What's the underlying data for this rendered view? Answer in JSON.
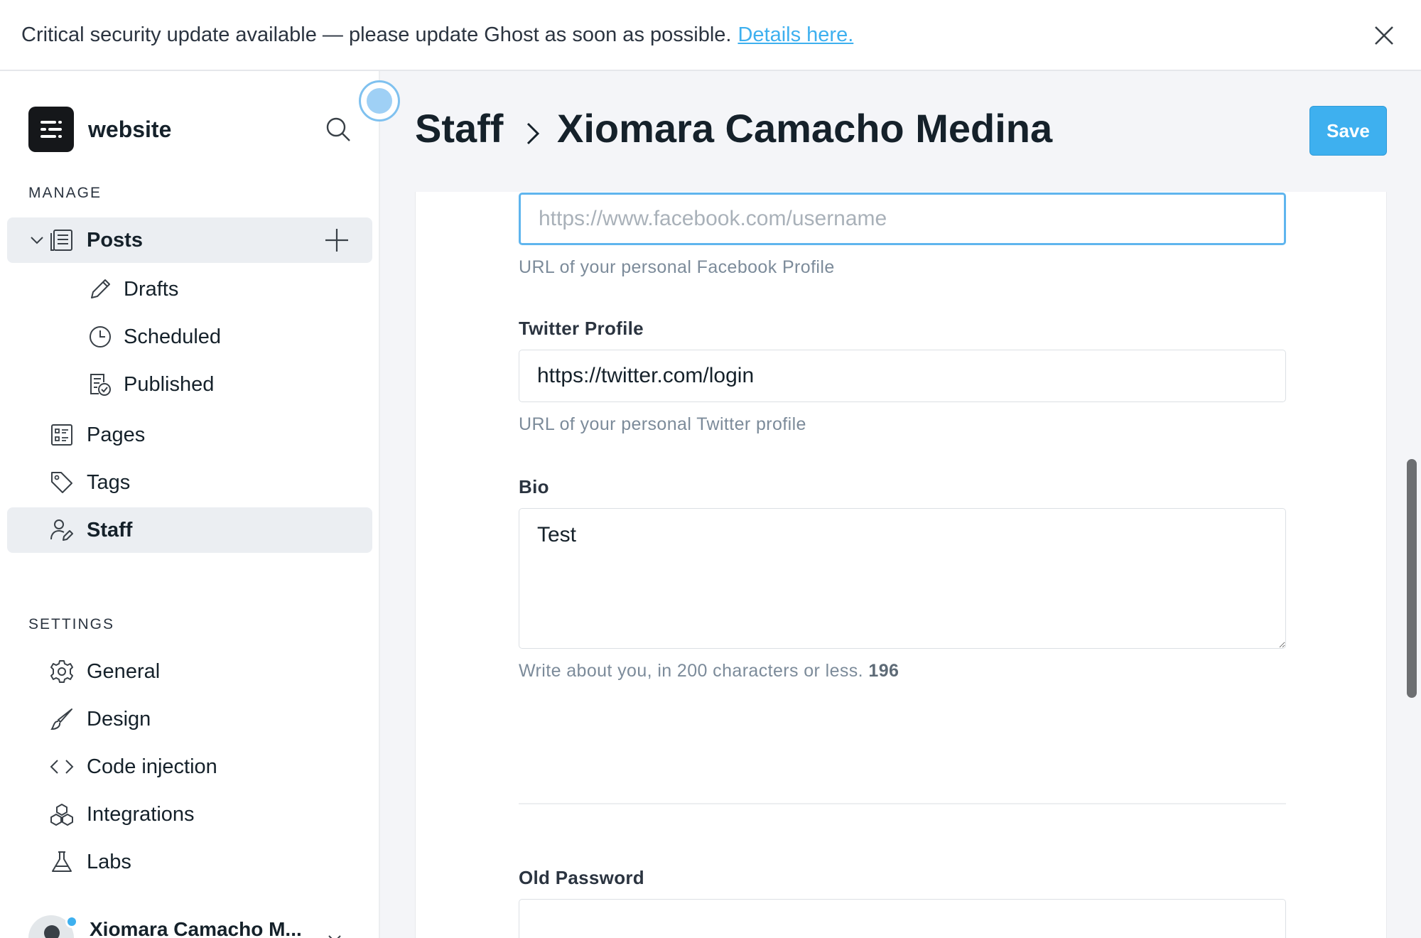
{
  "banner": {
    "message": "Critical security update available — please update Ghost as soon as possible.",
    "link": "Details here."
  },
  "sidebar": {
    "site_name": "website",
    "manage_label": "MANAGE",
    "settings_label": "SETTINGS",
    "posts": {
      "label": "Posts",
      "children": [
        {
          "label": "Drafts",
          "icon": "pencil-icon"
        },
        {
          "label": "Scheduled",
          "icon": "clock-icon"
        },
        {
          "label": "Published",
          "icon": "published-icon"
        }
      ]
    },
    "manage_items": [
      {
        "label": "Pages",
        "icon": "pages-icon"
      },
      {
        "label": "Tags",
        "icon": "tag-icon"
      },
      {
        "label": "Staff",
        "icon": "staff-icon",
        "active": true
      }
    ],
    "settings_items": [
      {
        "label": "General",
        "icon": "gear-icon"
      },
      {
        "label": "Design",
        "icon": "brush-icon"
      },
      {
        "label": "Code injection",
        "icon": "code-icon"
      },
      {
        "label": "Integrations",
        "icon": "integrations-icon"
      },
      {
        "label": "Labs",
        "icon": "flask-icon"
      }
    ],
    "user": {
      "name": "Xiomara Camacho M..."
    }
  },
  "header": {
    "breadcrumb_parent": "Staff",
    "breadcrumb_current": "Xiomara Camacho Medina",
    "save_label": "Save"
  },
  "form": {
    "facebook": {
      "placeholder": "https://www.facebook.com/username",
      "value": "",
      "hint": "URL of your personal Facebook Profile"
    },
    "twitter": {
      "label": "Twitter Profile",
      "value": "https://twitter.com/login",
      "hint": "URL of your personal Twitter profile"
    },
    "bio": {
      "label": "Bio",
      "value": "Test",
      "hint": "Write about you, in 200 characters or less.",
      "count": "196"
    },
    "old_password": {
      "label": "Old Password",
      "value": ""
    }
  },
  "colors": {
    "accent": "#3eb0ef",
    "link": "#3eb0ef",
    "active_nav_bg": "#ebeef2"
  }
}
